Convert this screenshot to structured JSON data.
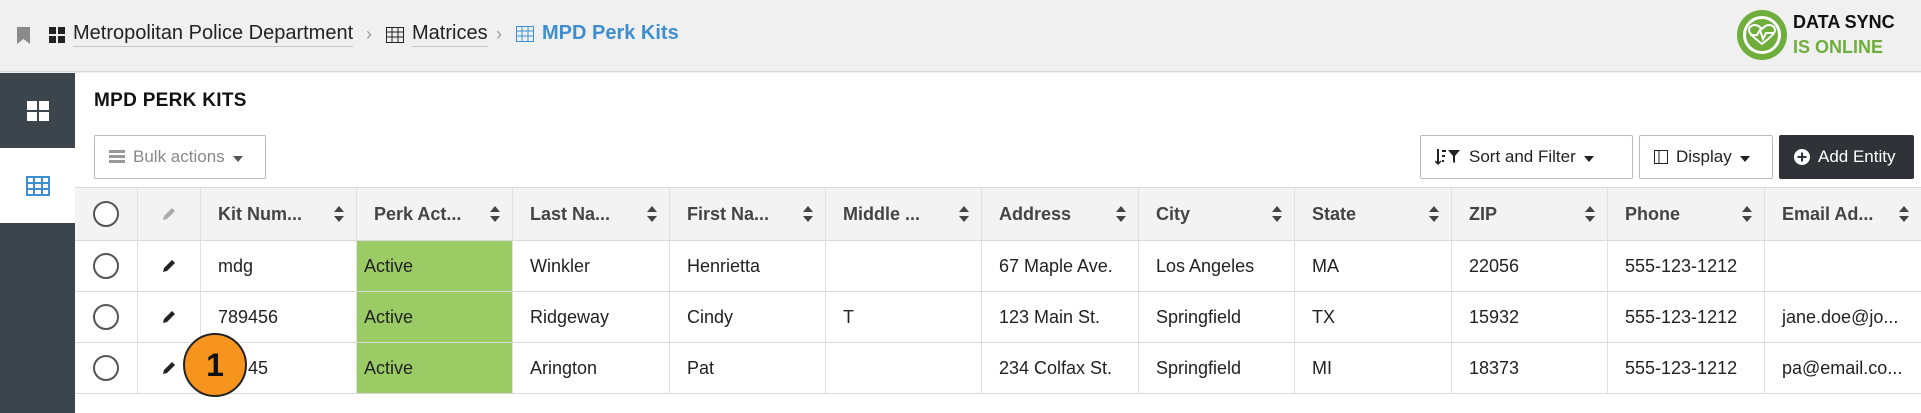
{
  "breadcrumb": {
    "items": [
      {
        "label": "Metropolitan Police Department",
        "icon": "dashboard-icon"
      },
      {
        "label": "Matrices",
        "icon": "table-icon"
      },
      {
        "label": "MPD Perk Kits",
        "icon": "table-icon"
      }
    ],
    "separator": "›"
  },
  "sync": {
    "line1": "DATA SYNC",
    "line2": "IS ONLINE",
    "color": "#6fae3c"
  },
  "sidebar": {
    "items": [
      {
        "name": "dashboard",
        "icon": "dashboard-icon"
      },
      {
        "name": "matrices",
        "icon": "table-icon",
        "active": true
      }
    ]
  },
  "page": {
    "title": "MPD PERK KITS"
  },
  "toolbar": {
    "bulk_label": "Bulk actions",
    "sort_label": "Sort and Filter",
    "display_label": "Display",
    "add_label": "Add Entity"
  },
  "table": {
    "columns": [
      "Kit Num...",
      "Perk Act...",
      "Last Na...",
      "First Na...",
      "Middle ...",
      "Address",
      "City",
      "State",
      "ZIP",
      "Phone",
      "Email Ad..."
    ],
    "rows": [
      {
        "kit": "mdg",
        "perk": "Active",
        "last": "Winkler",
        "first": "Henrietta",
        "middle": "",
        "address": "67 Maple Ave.",
        "city": "Los Angeles",
        "state": "MA",
        "zip": "22056",
        "phone": "555-123-1212",
        "email": ""
      },
      {
        "kit": "789456",
        "perk": "Active",
        "last": "Ridgeway",
        "first": "Cindy",
        "middle": "T",
        "address": "123 Main St.",
        "city": "Springfield",
        "state": "TX",
        "zip": "15932",
        "phone": "555-123-1212",
        "email": "jane.doe@jo..."
      },
      {
        "kit": "45",
        "perk": "Active",
        "last": "Arington",
        "first": "Pat",
        "middle": "",
        "address": "234 Colfax St.",
        "city": "Springfield",
        "state": "MI",
        "zip": "18373",
        "phone": "555-123-1212",
        "email": "pa@email.co..."
      }
    ],
    "active_color": "#9bcb64"
  },
  "marker": {
    "label": "1"
  }
}
